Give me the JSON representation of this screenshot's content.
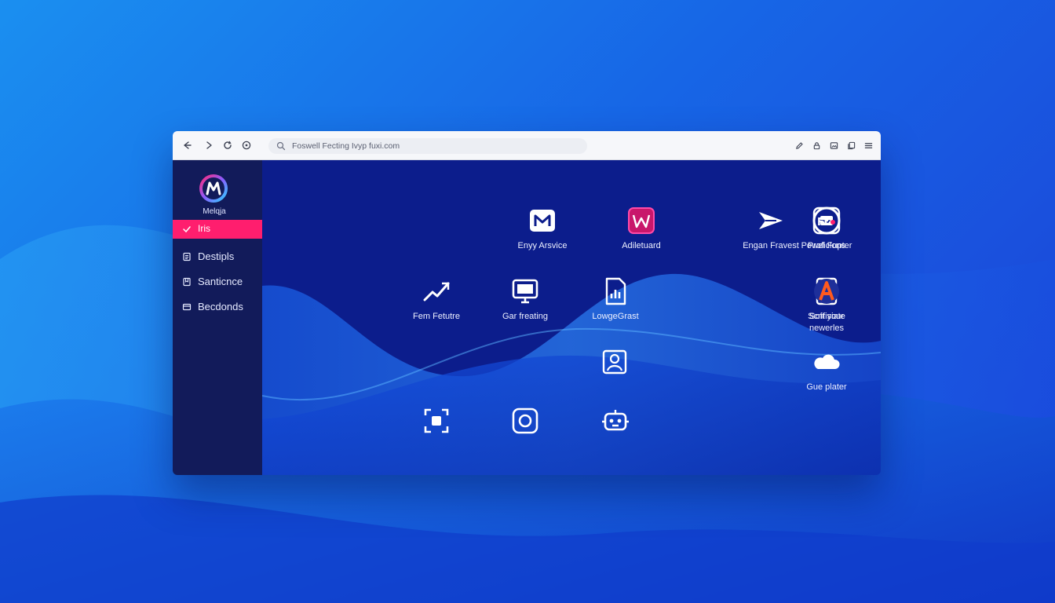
{
  "colors": {
    "accent": "#ff1e6e",
    "sidebar_bg": "#121b5a",
    "content_bg": "#0c1d8c",
    "toolbar_bg": "#f6f7fa"
  },
  "toolbar": {
    "back_icon": "back-arrow-icon",
    "forward_icon": "forward-arrow-icon",
    "reload_icon": "reload-icon",
    "info_icon": "info-icon",
    "address_text": "Foswell Fecting Ivyp fuxi.com",
    "right_icons": [
      "edit-icon",
      "lock-icon",
      "image-icon",
      "copy-icon",
      "menu-icon"
    ]
  },
  "sidebar": {
    "logo_label": "Melqja",
    "items": [
      {
        "label": "Iris",
        "icon": "check-icon",
        "active": true
      },
      {
        "label": "Destipls",
        "icon": "document-icon",
        "active": false
      },
      {
        "label": "Santicnce",
        "icon": "bookmark-icon",
        "active": false
      },
      {
        "label": "Becdonds",
        "icon": "card-icon",
        "active": false
      }
    ]
  },
  "apps": [
    {
      "label": "Enyy Arsvice",
      "icon": "mail-icon"
    },
    {
      "label": "Adiletuard",
      "icon": "magenta-w-icon"
    },
    {
      "label": "Engan Fravest",
      "icon": "send-plane-icon"
    },
    {
      "label": "Powel Fupter",
      "icon": "circle-inbox-icon"
    },
    {
      "label": "Proficlons",
      "icon": "fo-badge-icon"
    },
    {
      "label": "Fem Fetutre",
      "icon": "trend-line-icon"
    },
    {
      "label": "Gar freating",
      "icon": "monitor-icon"
    },
    {
      "label": "LowgeGrast",
      "icon": "bar-file-icon"
    },
    {
      "label": "Scnfisiate",
      "icon": "document-seal-icon"
    },
    {
      "label": "Soft your\nnewerles",
      "icon": "orange-a-icon"
    },
    {
      "label": "",
      "icon": "person-frame-icon"
    },
    {
      "label": "Gue plater",
      "icon": "cloud-icon"
    },
    {
      "label": "",
      "icon": "scan-bracket-icon"
    },
    {
      "label": "",
      "icon": "camera-icon"
    },
    {
      "label": "",
      "icon": "robot-icon"
    }
  ]
}
